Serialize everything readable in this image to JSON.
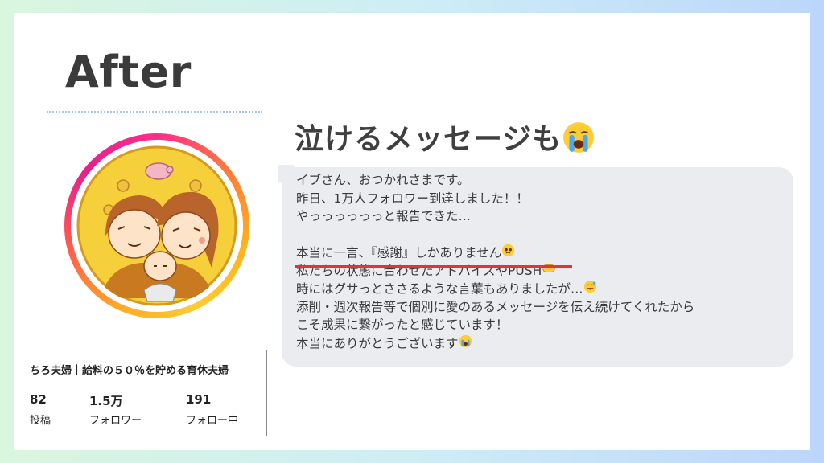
{
  "heading": "After",
  "subtitle": "泣けるメッセージも",
  "profile": {
    "name": "ちろ夫婦｜給料の５０％を貯める育休夫婦",
    "stats": [
      {
        "value": "82",
        "label": "投稿"
      },
      {
        "value": "1.5万",
        "label": "フォロワー"
      },
      {
        "value": "191",
        "label": "フォロー中"
      }
    ]
  },
  "message": {
    "lines": [
      "イブさん、おつかれさまです。",
      "昨日、1万人フォロワー到達しました！！",
      "やっっっっっっと報告できた…",
      "",
      "本当に一言、『感謝』しかありません",
      "私たちの状態に合わせたアドバイスやPUSH",
      "時にはグサっとささるような言葉もありましたが…",
      "添削・週次報告等で個別に愛のあるメッセージを伝え続けてくれたから",
      "こそ成果に繋がったと感じています！",
      "本当にありがとうございます"
    ]
  },
  "icons": {
    "subtitle": "loudly-crying-face-icon",
    "avatar": "couple-with-baby-avatar"
  },
  "colors": {
    "accent_underline": "#e23434",
    "bubble": "#ebecef",
    "ring_start": "#ff2d8a",
    "ring_end": "#ffb21b"
  }
}
